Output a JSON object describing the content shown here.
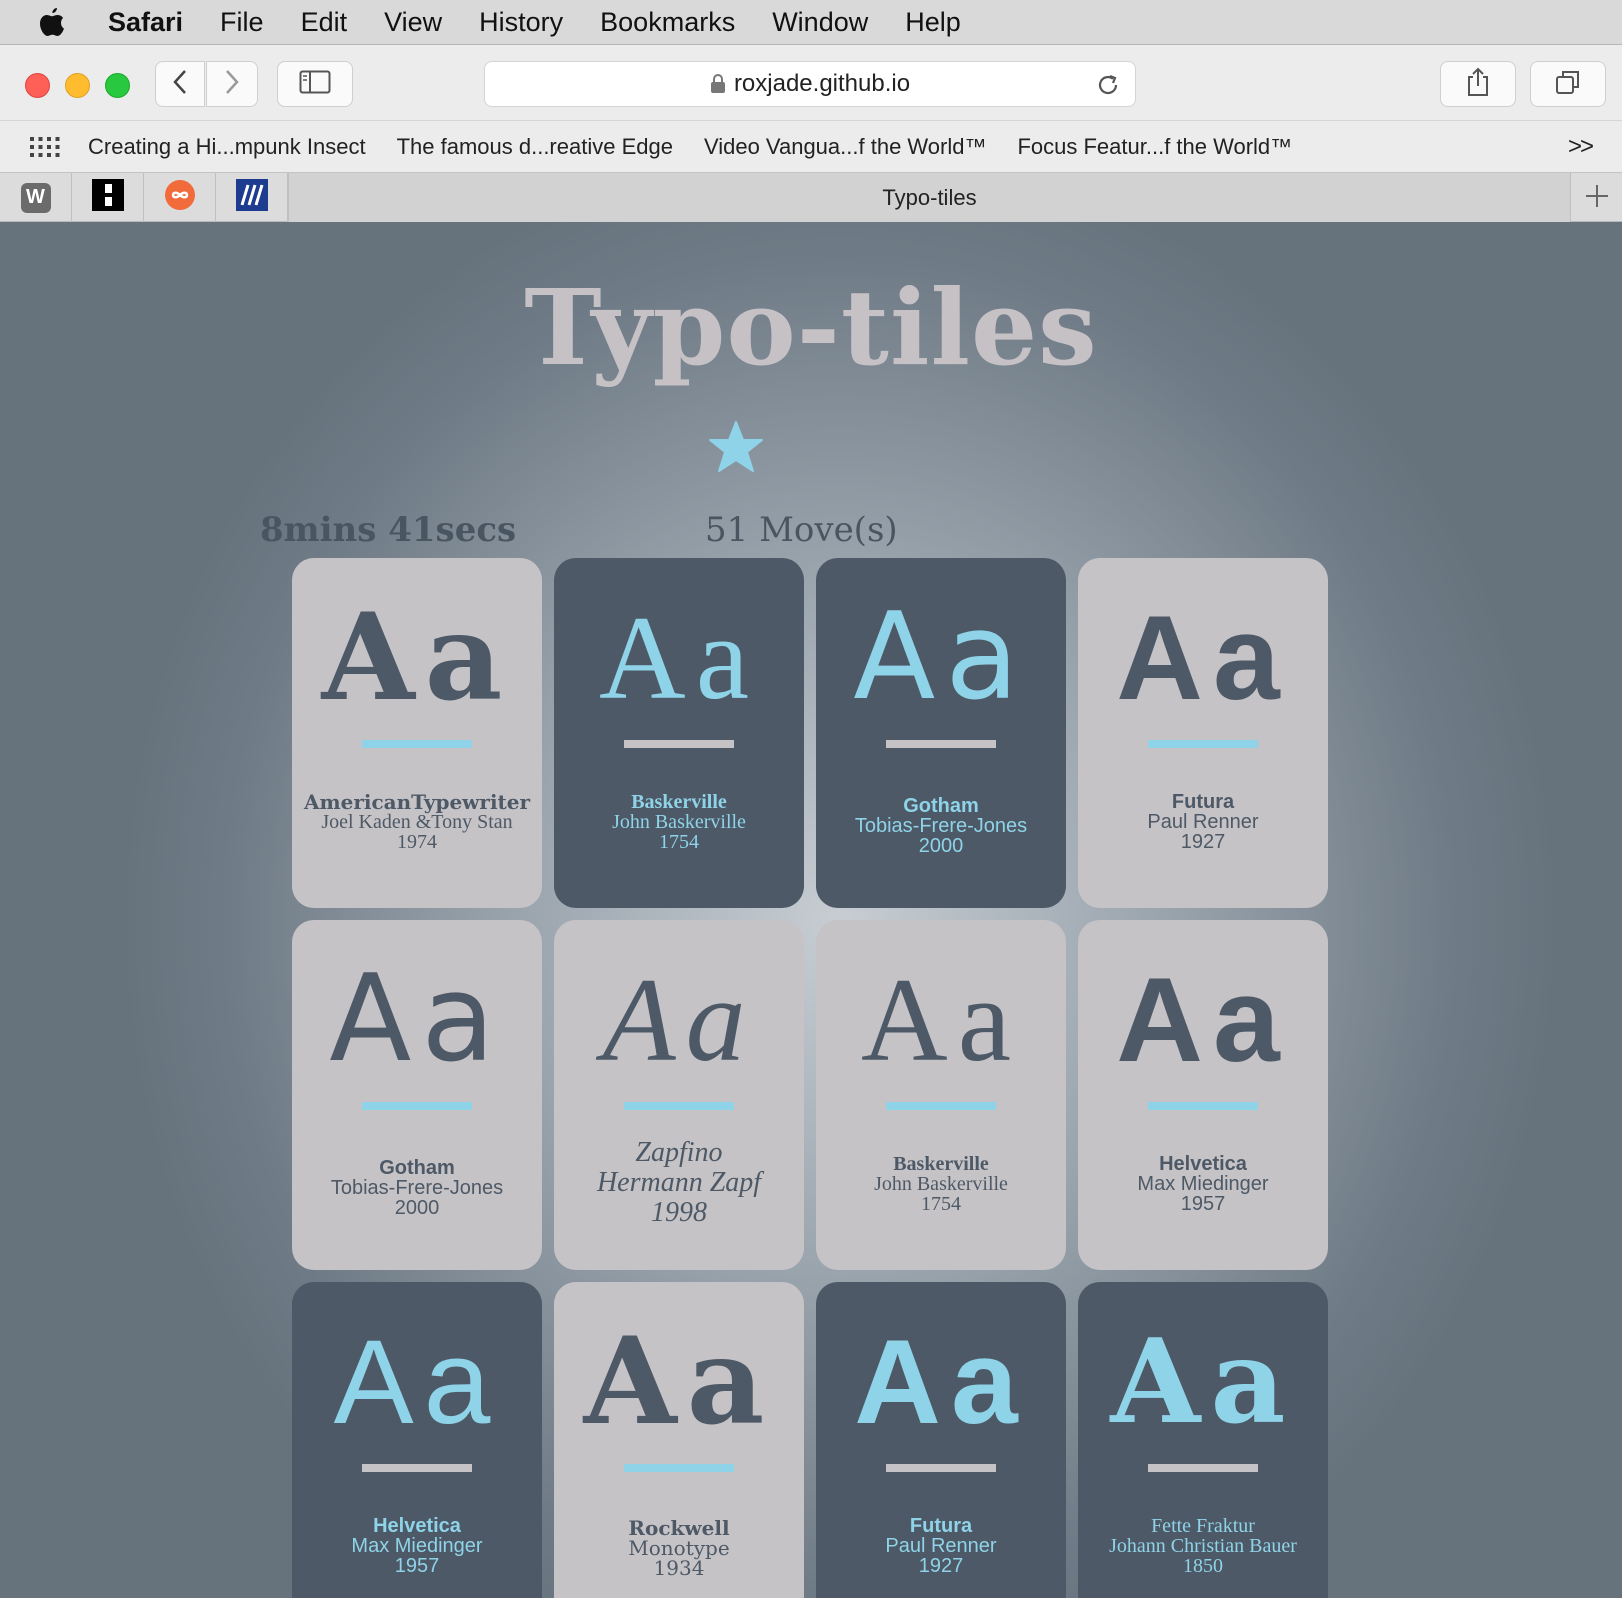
{
  "menubar": {
    "app": "Safari",
    "items": [
      "File",
      "Edit",
      "View",
      "History",
      "Bookmarks",
      "Window",
      "Help"
    ]
  },
  "toolbar": {
    "url": "roxjade.github.io"
  },
  "favorites": {
    "items": [
      "Creating a Hi...mpunk Insect",
      "The famous d...reative Edge",
      "Video Vangua...f the World™",
      "Focus Featur...f the World™"
    ],
    "more": ">>"
  },
  "tabs": {
    "active_title": "Typo-tiles",
    "pinned": [
      "W",
      "",
      "",
      ""
    ]
  },
  "game": {
    "title": "Typo-tiles",
    "timer": "8mins 41secs",
    "moves": "51 Move(s)",
    "tiles": [
      {
        "glyph": "Aa",
        "name": "AmericanTypewriter",
        "designer": "Joel Kaden &Tony Stan",
        "year": "1974",
        "style": "light"
      },
      {
        "glyph": "Aa",
        "name": "Baskerville",
        "designer": "John Baskerville",
        "year": "1754",
        "style": "dark"
      },
      {
        "glyph": "Aa",
        "name": "Gotham",
        "designer": "Tobias-Frere-Jones",
        "year": "2000",
        "style": "dark"
      },
      {
        "glyph": "Aa",
        "name": "Futura",
        "designer": "Paul Renner",
        "year": "1927",
        "style": "light"
      },
      {
        "glyph": "Aa",
        "name": "Gotham",
        "designer": "Tobias-Frere-Jones",
        "year": "2000",
        "style": "light"
      },
      {
        "glyph": "Aa",
        "name": "Zapfino",
        "designer": "Hermann Zapf",
        "year": "1998",
        "style": "light"
      },
      {
        "glyph": "Aa",
        "name": "Baskerville",
        "designer": "John Baskerville",
        "year": "1754",
        "style": "light"
      },
      {
        "glyph": "Aa",
        "name": "Helvetica",
        "designer": "Max Miedinger",
        "year": "1957",
        "style": "light"
      },
      {
        "glyph": "Aa",
        "name": "Helvetica",
        "designer": "Max Miedinger",
        "year": "1957",
        "style": "dark"
      },
      {
        "glyph": "Aa",
        "name": "Rockwell",
        "designer": "Monotype",
        "year": "1934",
        "style": "light"
      },
      {
        "glyph": "Aa",
        "name": "Futura",
        "designer": "Paul Renner",
        "year": "1927",
        "style": "dark"
      },
      {
        "glyph": "Aa",
        "name": "Fette Fraktur",
        "designer": "Johann Christian Bauer",
        "year": "1850",
        "style": "dark"
      }
    ]
  },
  "colors": {
    "tile_light": "#c6c3c6",
    "tile_dark": "#4d5966",
    "accent": "#8fd3e8",
    "title": "#c5c1c5"
  }
}
